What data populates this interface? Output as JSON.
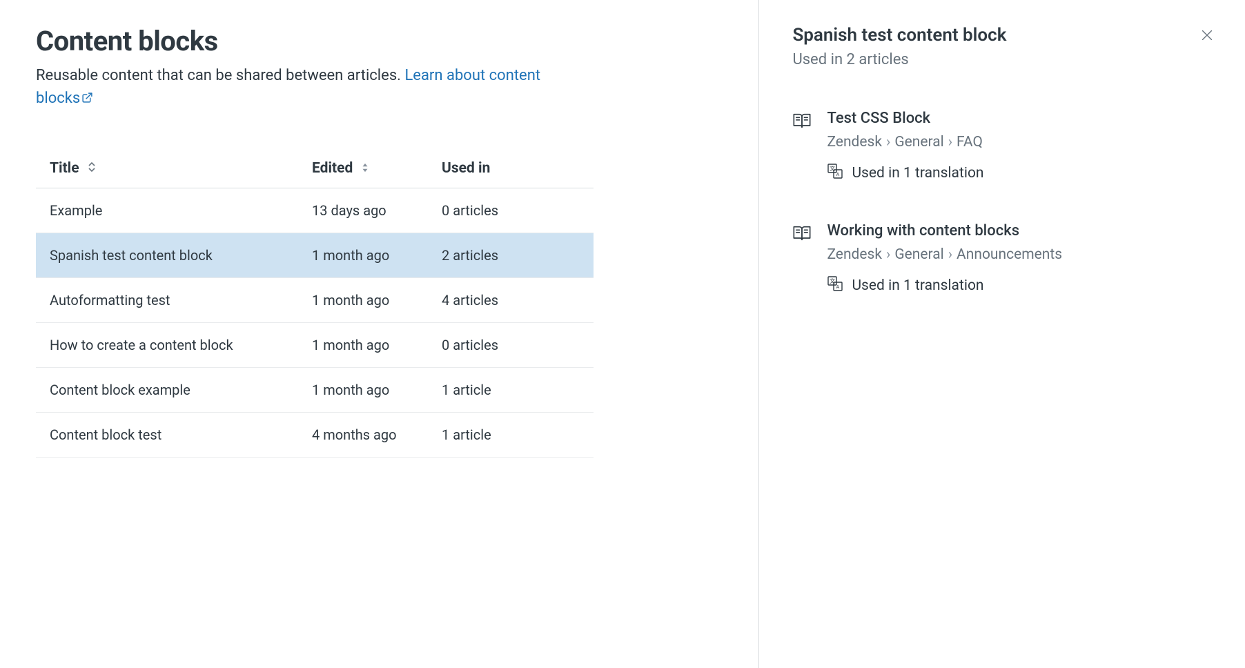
{
  "header": {
    "title": "Content blocks",
    "subtitle_plain": "Reusable content that can be shared between articles. ",
    "link_text": "Learn about content blocks"
  },
  "table": {
    "columns": {
      "title": "Title",
      "edited": "Edited",
      "used_in": "Used in"
    },
    "rows": [
      {
        "title": "Example",
        "edited": "13 days ago",
        "used_in": "0 articles",
        "selected": false
      },
      {
        "title": "Spanish test content block",
        "edited": "1 month ago",
        "used_in": "2 articles",
        "selected": true
      },
      {
        "title": "Autoformatting test",
        "edited": "1 month ago",
        "used_in": "4 articles",
        "selected": false
      },
      {
        "title": "How to create a content block",
        "edited": "1 month ago",
        "used_in": "0 articles",
        "selected": false
      },
      {
        "title": "Content block example",
        "edited": "1 month ago",
        "used_in": "1 article",
        "selected": false
      },
      {
        "title": "Content block test",
        "edited": "4 months ago",
        "used_in": "1 article",
        "selected": false
      }
    ]
  },
  "detail": {
    "title": "Spanish test content block",
    "subtitle": "Used in 2 articles",
    "articles": [
      {
        "title": "Test CSS Block",
        "breadcrumb": [
          "Zendesk",
          "General",
          "FAQ"
        ],
        "translation": "Used in 1 translation"
      },
      {
        "title": "Working with content blocks",
        "breadcrumb": [
          "Zendesk",
          "General",
          "Announcements"
        ],
        "translation": "Used in 1 translation"
      }
    ]
  }
}
